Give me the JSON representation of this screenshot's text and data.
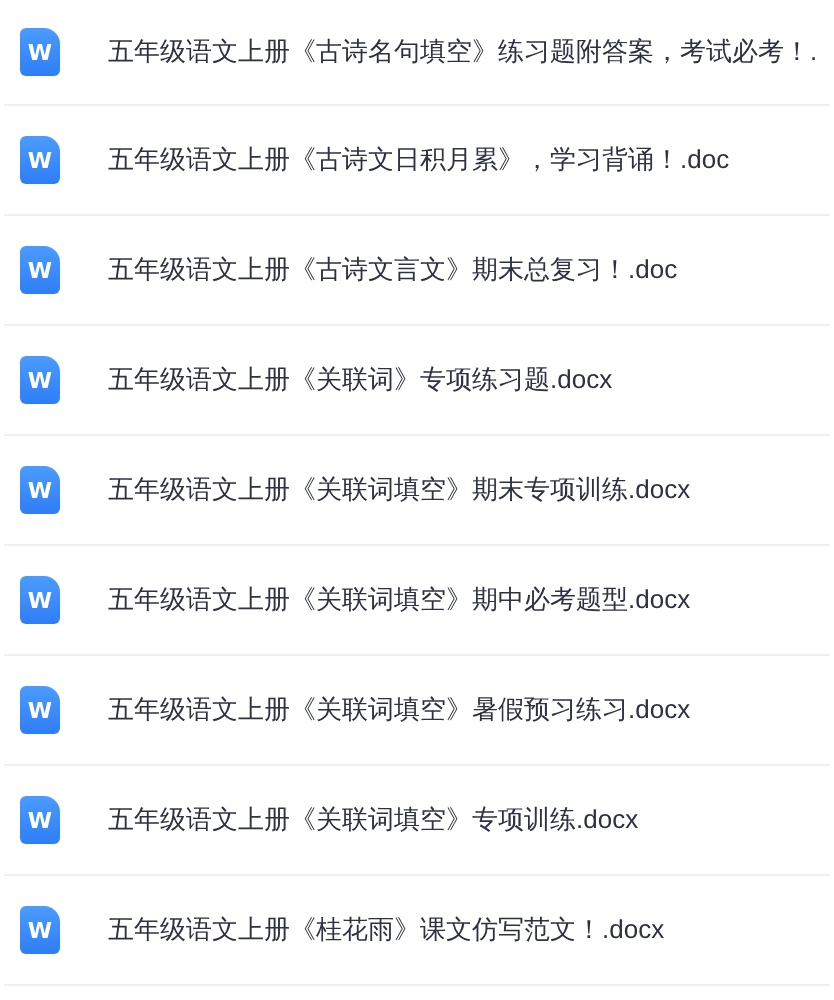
{
  "files": [
    {
      "icon": "W",
      "name": "五年级语文上册《古诗名句填空》练习题附答案，考试必考！."
    },
    {
      "icon": "W",
      "name": "五年级语文上册《古诗文日积月累》，学习背诵！.doc"
    },
    {
      "icon": "W",
      "name": "五年级语文上册《古诗文言文》期末总复习！.doc"
    },
    {
      "icon": "W",
      "name": "五年级语文上册《关联词》专项练习题.docx"
    },
    {
      "icon": "W",
      "name": "五年级语文上册《关联词填空》期末专项训练.docx"
    },
    {
      "icon": "W",
      "name": "五年级语文上册《关联词填空》期中必考题型.docx"
    },
    {
      "icon": "W",
      "name": "五年级语文上册《关联词填空》暑假预习练习.docx"
    },
    {
      "icon": "W",
      "name": "五年级语文上册《关联词填空》专项训练.docx"
    },
    {
      "icon": "W",
      "name": "五年级语文上册《桂花雨》课文仿写范文！.docx"
    }
  ]
}
